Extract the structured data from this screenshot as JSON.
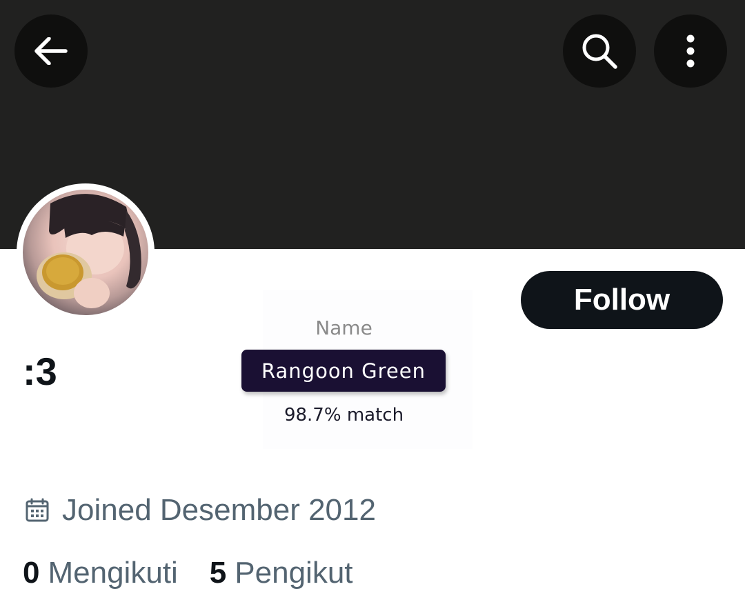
{
  "header": {
    "back_icon": "arrow-left-icon",
    "search_icon": "search-icon",
    "more_icon": "more-vertical-icon",
    "banner_color": "#212120"
  },
  "profile": {
    "avatar_icon": "avatar",
    "display_name": ":3",
    "follow_label": "Follow",
    "joined_icon": "calendar-icon",
    "joined_text": "Joined Desember 2012",
    "stats": [
      {
        "count": "0",
        "label": "Mengikuti"
      },
      {
        "count": "5",
        "label": "Pengikut"
      }
    ]
  },
  "name_match": {
    "label": "Name",
    "color_name": "Rangoon Green",
    "score": "98.7% match",
    "pill_color": "#1a1033"
  }
}
